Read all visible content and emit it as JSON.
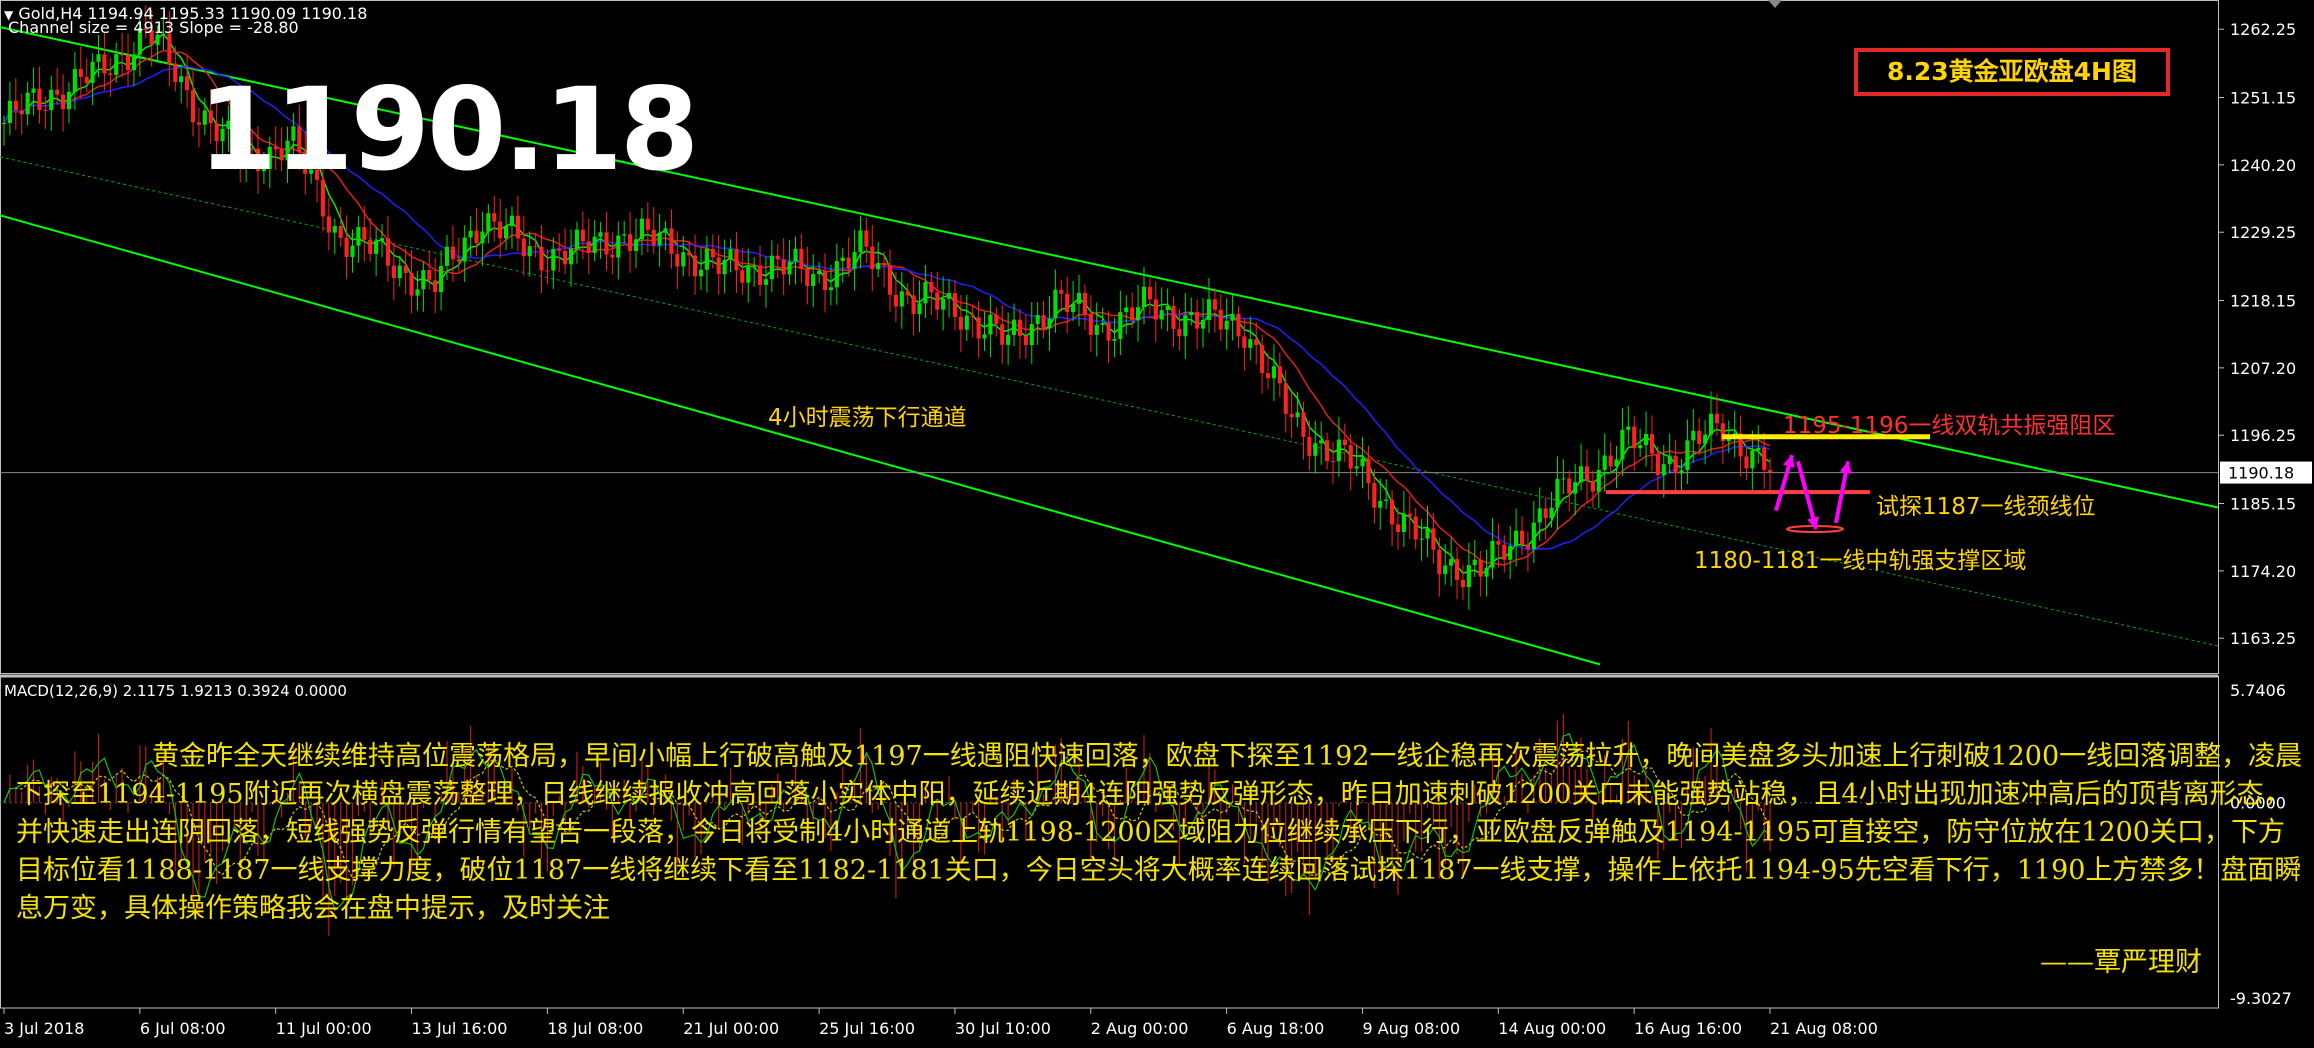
{
  "header": {
    "symbol_line": "Gold,H4  1194.94 1195.33 1190.09 1190.18",
    "indicator_line": "Channel size = 4913 Slope = -28.80",
    "big_price": "1190.18",
    "title_box": "8.23黄金亚欧盘4H图",
    "current_price_tag": "1190.18"
  },
  "annotations": {
    "channel_label": "4小时震荡下行通道",
    "resistance_label": "1195-1196一线双轨共振强阻区",
    "neckline_label": "试探1187一线颈线位",
    "support_label": "1180-1181一线中轨强支撑区域"
  },
  "macd_panel": {
    "label": "MACD(12,26,9) 2.1175 1.9213 0.3924 0.0000",
    "top_value": "5.7406",
    "zero_value": "0.0000",
    "bottom_value": "-9.3027"
  },
  "commentary": {
    "text": "黄金昨全天继续维持高位震荡格局，早间小幅上行破高触及1197一线遇阻快速回落，欧盘下探至1192一线企稳再次震荡拉升，晚间美盘多头加速上行刺破1200一线回落调整，凌晨下探至1194-1195附近再次横盘震荡整理，日线继续报收冲高回落小实体中阳，延续近期4连阳强势反弹形态，昨日加速刺破1200关口未能强势站稳，且4小时出现加速冲高后的顶背离形态，并快速走出连阴回落，短线强势反弹行情有望告一段落，今日将受制4小时通道上轨1198-1200区域阻力位继续承压下行，亚欧盘反弹触及1194-1195可直接空，防守位放在1200关口，下方目标位看1188-1187一线支撑力度，破位1187一线将继续下看至1182-1181关口，今日空头将大概率连续回落试探1187一线支撑，操作上依托1194-95先空看下行，1190上方禁多！盘面瞬息万变，具体操作策略我会在盘中提示，及时关注",
    "signature": "——覃严理财"
  },
  "colors": {
    "background": "#000000",
    "bull_candle": "#00e000",
    "bear_candle": "#ff2020",
    "channel": "#00ff00",
    "fast_ma": "#00ee00",
    "mid_ma": "#e02020",
    "slow_ma": "#2020ff",
    "resistance_line": "#ffee00",
    "support_line": "#ff4040",
    "arrow": "#ff00ff",
    "annotation_text": "#ffd400",
    "resistance_text": "#ff3030",
    "commentary": "#f5e200"
  },
  "chart_data": [
    {
      "type": "candlestick",
      "symbol": "Gold",
      "timeframe": "H4",
      "ohlc_last": {
        "open": 1194.94,
        "high": 1195.33,
        "low": 1190.09,
        "close": 1190.18
      },
      "ylim": [
        1157.6,
        1267.0
      ],
      "y_ticks": [
        "1262.25",
        "1251.15",
        "1240.20",
        "1229.25",
        "1218.15",
        "1207.20",
        "1196.25",
        "1185.15",
        "1174.20",
        "1163.25"
      ],
      "x_ticks": [
        "3 Jul 2018",
        "6 Jul 08:00",
        "11 Jul 00:00",
        "13 Jul 16:00",
        "18 Jul 08:00",
        "21 Jul 00:00",
        "25 Jul 16:00",
        "30 Jul 10:00",
        "2 Aug 00:00",
        "6 Aug 18:00",
        "9 Aug 08:00",
        "14 Aug 00:00",
        "16 Aug 16:00",
        "21 Aug 08:00"
      ],
      "price_path": [
        1247,
        1252,
        1255,
        1262,
        1250,
        1241,
        1244,
        1229,
        1225,
        1220,
        1232,
        1226,
        1226,
        1229,
        1227,
        1223,
        1224,
        1222,
        1226,
        1218,
        1217,
        1211,
        1218,
        1214,
        1217,
        1215,
        1214,
        1198,
        1193,
        1185,
        1176,
        1174,
        1182,
        1189,
        1195,
        1192,
        1198,
        1190
      ],
      "levels": {
        "resistance": 1196.0,
        "neckline": 1187.0,
        "support": 1181.0
      }
    },
    {
      "type": "bar",
      "name": "MACD(12,26,9)",
      "values": [
        2.1175,
        1.9213,
        0.3924,
        0.0
      ],
      "ylim": [
        -9.3027,
        5.7406
      ]
    }
  ]
}
